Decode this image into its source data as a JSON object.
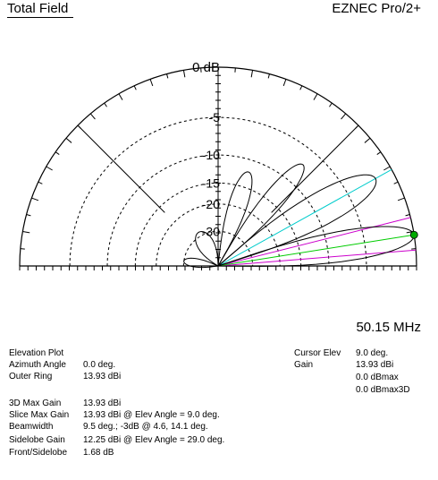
{
  "header": {
    "title": "Total Field",
    "product": "EZNEC Pro/2+"
  },
  "plot": {
    "ring_labels": [
      "0 dB",
      "-5",
      "-10",
      "-15",
      "-20",
      "-30"
    ],
    "ring_db": [
      0,
      -5,
      -10,
      -15,
      -20,
      -30
    ],
    "frequency": "50.15 MHz",
    "colors": {
      "pattern": "#000000",
      "main_axis": "#00cc00",
      "max_elev": "#00cccc",
      "beamwidth": "#cc00cc",
      "cursor_dot": "#00aa00"
    }
  },
  "chart_data": {
    "type": "polar",
    "scale": "dB",
    "outer_ring_dbi": 13.93,
    "lobes": [
      {
        "elev_deg": 9.0,
        "rel_db": 0.0
      },
      {
        "elev_deg": 29.0,
        "rel_db": -1.68
      },
      {
        "elev_deg": 50.0,
        "rel_db": -7.0
      },
      {
        "elev_deg": 72.0,
        "rel_db": -12.0
      },
      {
        "elev_deg": 120.0,
        "rel_db": -28.0
      },
      {
        "elev_deg": 172.0,
        "rel_db": -30.0
      }
    ],
    "lines_deg": {
      "cursor": 9.0,
      "lobe": 29.0,
      "beamwidth_low": 4.6,
      "beamwidth_high": 14.1
    }
  },
  "info": {
    "left": [
      {
        "label": "Elevation Plot",
        "value": ""
      },
      {
        "label": "Azimuth Angle",
        "value": "0.0 deg."
      },
      {
        "label": "Outer Ring",
        "value": "13.93 dBi"
      },
      {
        "label": "3D Max Gain",
        "value": "13.93 dBi"
      },
      {
        "label": "Slice Max Gain",
        "value": "13.93 dBi @ Elev Angle = 9.0 deg."
      },
      {
        "label": "Beamwidth",
        "value": "9.5 deg.; -3dB @ 4.6, 14.1 deg."
      },
      {
        "label": "Sidelobe Gain",
        "value": "12.25 dBi @ Elev Angle = 29.0 deg."
      },
      {
        "label": "Front/Sidelobe",
        "value": "1.68 dB"
      }
    ],
    "right": [
      {
        "label": "Cursor Elev",
        "value": "9.0 deg."
      },
      {
        "label": "Gain",
        "value": "13.93 dBi"
      },
      {
        "label": "",
        "value": "0.0 dBmax"
      },
      {
        "label": "",
        "value": "0.0 dBmax3D"
      }
    ]
  }
}
